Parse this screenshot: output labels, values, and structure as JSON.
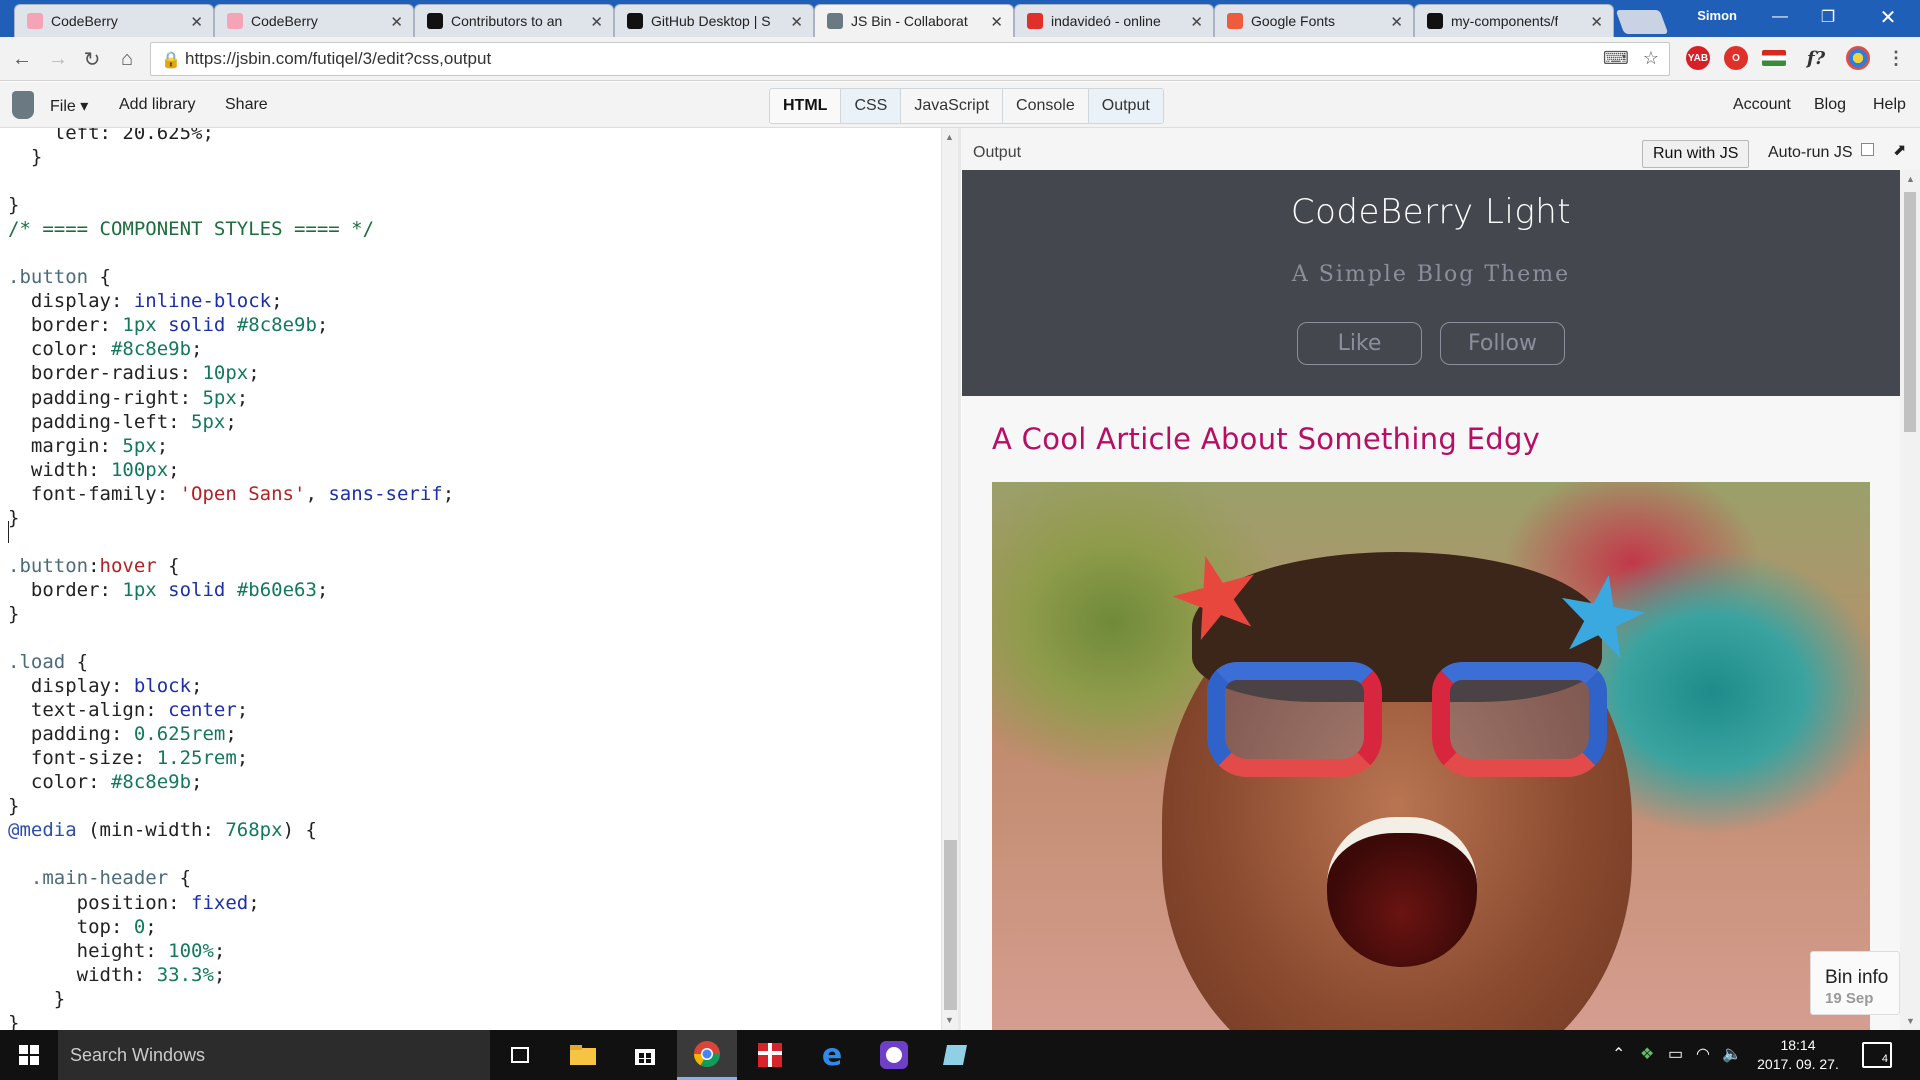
{
  "browser": {
    "tabs": [
      {
        "title": "CodeBerry",
        "favicon_color": "#f5a3b6",
        "icon": "codeberry-icon"
      },
      {
        "title": "CodeBerry",
        "favicon_color": "#f5a3b6",
        "icon": "codeberry-icon"
      },
      {
        "title": "Contributors to an",
        "favicon_color": "#111111",
        "icon": "github-icon"
      },
      {
        "title": "GitHub Desktop | S",
        "favicon_color": "#111111",
        "icon": "github-icon"
      },
      {
        "title": "JS Bin - Collaborat",
        "favicon_color": "#6b7a82",
        "icon": "jsbin-icon"
      },
      {
        "title": "indavideó - online",
        "favicon_color": "#e0302a",
        "icon": "indavideo-icon"
      },
      {
        "title": "Google Fonts",
        "favicon_color": "#ef5b3d",
        "icon": "google-fonts-icon"
      },
      {
        "title": "my-components/f",
        "favicon_color": "#111111",
        "icon": "github-icon"
      }
    ],
    "user": "Simon",
    "url": "https://jsbin.com/futiqel/3/edit?css,output"
  },
  "jsbin": {
    "menu": {
      "file": "File ▾",
      "add_library": "Add library",
      "share": "Share"
    },
    "panels": [
      "HTML",
      "CSS",
      "JavaScript",
      "Console",
      "Output"
    ],
    "right_menu": {
      "account": "Account",
      "blog": "Blog",
      "help": "Help"
    },
    "output_label": "Output",
    "run_button": "Run with JS",
    "auto_run": "Auto-run JS",
    "bin_info": {
      "title": "Bin info",
      "date": "19 Sep"
    }
  },
  "preview": {
    "site_title": "CodeBerry Light",
    "site_subtitle": "A Simple Blog Theme",
    "like_button": "Like",
    "follow_button": "Follow",
    "article_title": "A Cool Article About Something Edgy",
    "colors": {
      "header_bg": "#45474f",
      "accent": "#b60e63",
      "muted": "#8c8e9b"
    }
  },
  "taskbar": {
    "search_placeholder": "Search Windows",
    "time": "18:14",
    "date": "2017. 09. 27.",
    "notification_count": "4"
  }
}
